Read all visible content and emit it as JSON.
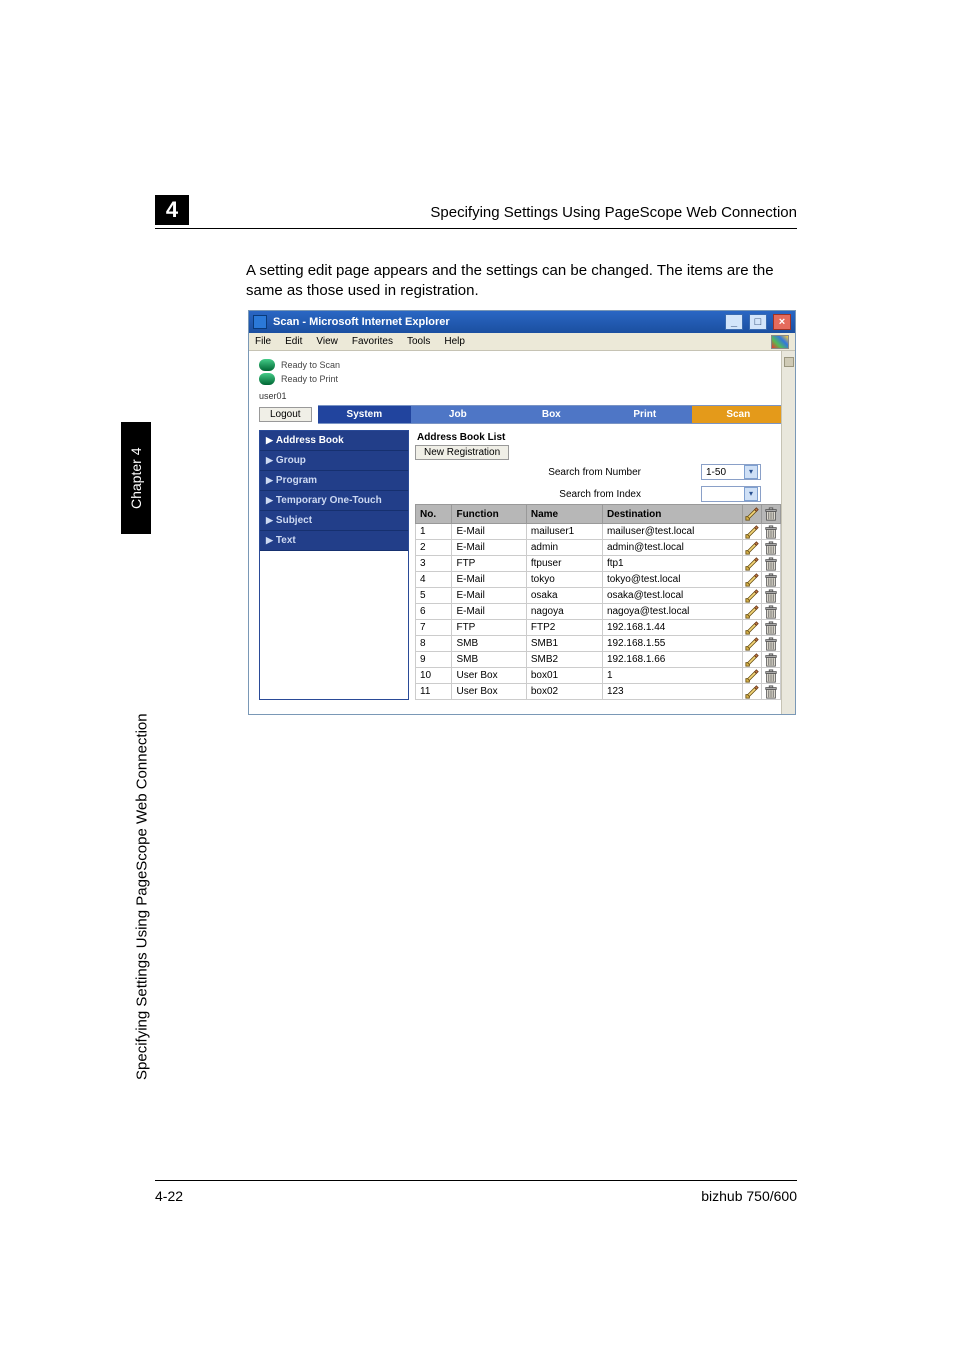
{
  "chapter_number": "4",
  "header_title": "Specifying Settings Using PageScope Web Connection",
  "body_text": "A setting edit page appears and the settings can be changed. The items are the same as those used in registration.",
  "side_tab": "Chapter 4",
  "side_label": "Specifying Settings Using PageScope Web Connection",
  "footer_left": "4-22",
  "footer_right": "bizhub 750/600",
  "shot": {
    "window_title": "Scan - Microsoft Internet Explorer",
    "menubar": [
      "File",
      "Edit",
      "View",
      "Favorites",
      "Tools",
      "Help"
    ],
    "status": {
      "scan": "Ready to Scan",
      "print": "Ready to Print"
    },
    "user": "user01",
    "logout": "Logout",
    "tabs": {
      "system": "System",
      "job": "Job",
      "box": "Box",
      "print": "Print",
      "scan": "Scan"
    },
    "sidenav": [
      "Address Book",
      "Group",
      "Program",
      "Temporary One-Touch",
      "Subject",
      "Text"
    ],
    "panel": {
      "title": "Address Book List",
      "new_registration": "New Registration",
      "search_num_label": "Search from Number",
      "search_num_value": "1-50",
      "search_idx_label": "Search from Index",
      "search_idx_value": "",
      "columns": {
        "no": "No.",
        "func": "Function",
        "name": "Name",
        "dest": "Destination"
      },
      "rows": [
        {
          "no": "1",
          "func": "E-Mail",
          "name": "mailuser1",
          "dest": "mailuser@test.local"
        },
        {
          "no": "2",
          "func": "E-Mail",
          "name": "admin",
          "dest": "admin@test.local"
        },
        {
          "no": "3",
          "func": "FTP",
          "name": "ftpuser",
          "dest": "ftp1"
        },
        {
          "no": "4",
          "func": "E-Mail",
          "name": "tokyo",
          "dest": "tokyo@test.local"
        },
        {
          "no": "5",
          "func": "E-Mail",
          "name": "osaka",
          "dest": "osaka@test.local"
        },
        {
          "no": "6",
          "func": "E-Mail",
          "name": "nagoya",
          "dest": "nagoya@test.local"
        },
        {
          "no": "7",
          "func": "FTP",
          "name": "FTP2",
          "dest": "192.168.1.44"
        },
        {
          "no": "8",
          "func": "SMB",
          "name": "SMB1",
          "dest": "192.168.1.55"
        },
        {
          "no": "9",
          "func": "SMB",
          "name": "SMB2",
          "dest": "192.168.1.66"
        },
        {
          "no": "10",
          "func": "User Box",
          "name": "box01",
          "dest": "1"
        },
        {
          "no": "11",
          "func": "User Box",
          "name": "box02",
          "dest": "123"
        }
      ]
    }
  }
}
